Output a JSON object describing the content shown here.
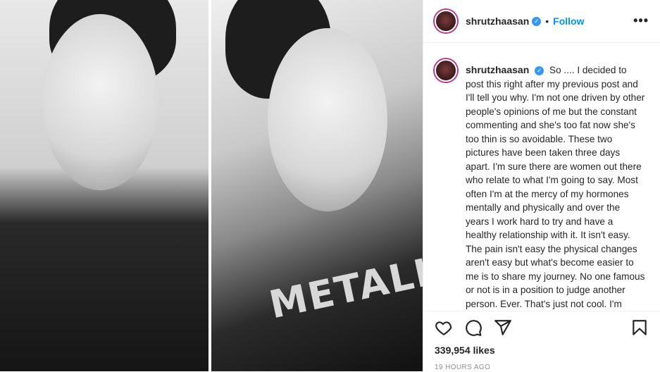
{
  "post": {
    "username": "shrutzhaasan",
    "verified_icon": "verified-badge-icon",
    "follow_label": "Follow",
    "separator": "•",
    "more_label": "•••",
    "shirt_print": "METALLIC",
    "caption": "So .... I decided to post this right after my previous post and I'll tell you why. I'm not one driven by other people's opinions of me but the constant commenting and she's too fat now she's too thin is so avoidable. These two pictures have been taken three days apart. I'm sure there are women out there who relate to what I'm going to say. Most often I'm at the mercy of my hormones mentally and physically and over the years I work hard to try and have a healthy relationship with it. It isn't easy. The pain isn't easy the physical changes aren't easy but what's become easier to me is to share my journey. No one famous or not is in a position to judge another person. Ever. That's just not cool. I'm happy to",
    "likes": "339,954 likes",
    "timestamp": "19 HOURS AGO"
  },
  "colors": {
    "accent": "#0095f6",
    "verified": "#3897f0",
    "muted": "#8e8e8e",
    "border": "#efefef"
  }
}
